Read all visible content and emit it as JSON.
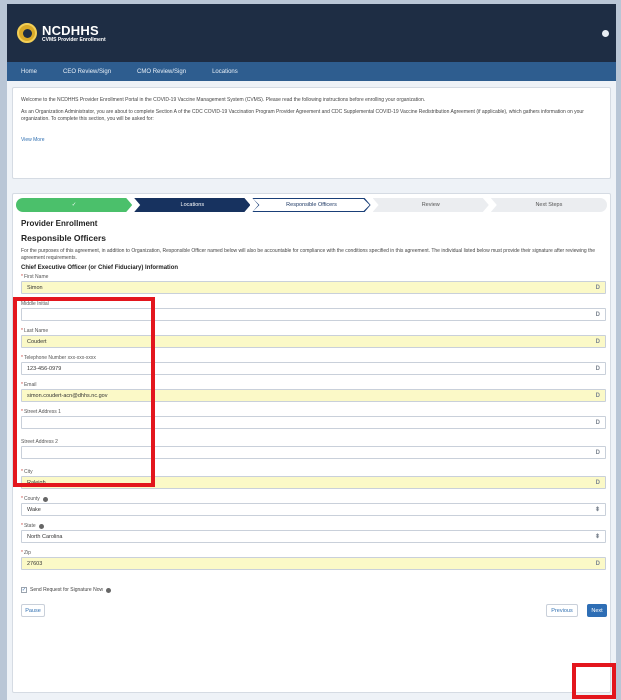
{
  "header": {
    "logo_title": "NCDHHS",
    "logo_subtitle": "CVMS Provider Enrollment"
  },
  "nav": {
    "items": [
      "Home",
      "CEO Review/Sign",
      "CMO Review/Sign",
      "Locations"
    ]
  },
  "intro": {
    "paragraph1": "Welcome to the NCDHHS Provider Enrollment Portal in the COVID-19 Vaccine Management System (CVMS). Please read the following instructions before enrolling your organization.",
    "paragraph2": "As an Organization Administrator, you are about to complete Section A of the CDC COVID-19 Vaccination Program Provider Agreement and CDC Supplemental COVID-19 Vaccine Redistribution Agreement (if applicable), which gathers information on your organization. To complete this section, you will be asked for:",
    "view_more": "View More"
  },
  "path": {
    "steps": [
      {
        "label": "✓",
        "state": "complete"
      },
      {
        "label": "Locations",
        "state": "current"
      },
      {
        "label": "Responsible Officers",
        "state": "active"
      },
      {
        "label": "Review",
        "state": "todo"
      },
      {
        "label": "Next Steps",
        "state": "todo"
      }
    ]
  },
  "form": {
    "section_title": "Provider Enrollment",
    "responsible_title": "Responsible Officers",
    "description": "For the purposes of this agreement, in addition to Organization, Responsible Officer named below will also be accountable for compliance with the conditions specified in this agreement. The individual listed below must provide their signature after reviewing the agreement requirements.",
    "subhead": "Chief Executive Officer (or Chief Fiduciary) Information",
    "fields": {
      "first_name": {
        "label": "First Name",
        "value": "Simon"
      },
      "middle_initial": {
        "label": "Middle Initial",
        "value": ""
      },
      "last_name": {
        "label": "Last Name",
        "value": "Coudert"
      },
      "telephone": {
        "label": "Telephone Number xxx-xxx-xxxx",
        "value": "123-456-0979"
      },
      "email": {
        "label": "Email",
        "value": "simon.coudert-acn@dhhs.nc.gov"
      },
      "street1": {
        "label": "Street Address 1",
        "value": ""
      },
      "street2": {
        "label": "Street Address 2",
        "value": ""
      },
      "city": {
        "label": "City",
        "value": "Raleigh"
      },
      "county": {
        "label": "County",
        "value": "Wake"
      },
      "state": {
        "label": "State",
        "value": "North Carolina"
      },
      "zip": {
        "label": "Zip",
        "value": "27603"
      }
    },
    "checkbox_label": "Send Request for Signature Now",
    "req_mark": "*",
    "buttons": {
      "pause": "Pause",
      "previous": "Previous",
      "next": "Next"
    }
  },
  "icons": {
    "text_icon": "D",
    "select_icon": "⬍",
    "check": "✓"
  },
  "colors": {
    "header_bg": "#1e2d44",
    "nav_bg": "#2e5d8f",
    "highlight": "#e3161d",
    "filled_bg": "#fbf9c7"
  }
}
